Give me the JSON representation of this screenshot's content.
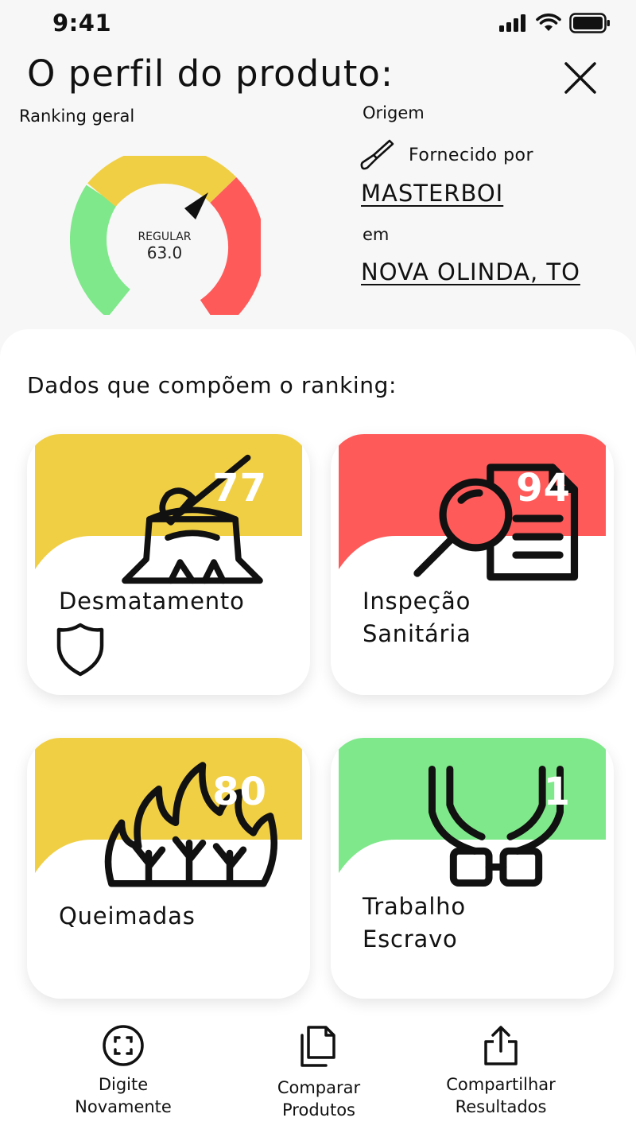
{
  "status_bar": {
    "time": "9:41"
  },
  "header": {
    "title": "O perfil do produto:",
    "close_icon": "close-icon"
  },
  "ranking": {
    "label": "Ranking geral",
    "status": "REGULAR",
    "score": "63.0",
    "score_value": 63.0,
    "colors": {
      "low": "#7ee88a",
      "mid": "#f0cf45",
      "high": "#ff5a5a"
    }
  },
  "origin": {
    "label": "Origem",
    "supplied_by_label": "Fornecido por",
    "supplier": "MASTERBOI",
    "em_label": "em",
    "location": "NOVA OLINDA, TO"
  },
  "panel": {
    "title": "Dados que compõem o ranking:"
  },
  "cards": [
    {
      "label": "Desmatamento",
      "score": "77",
      "color": "#f0cf45",
      "icon": "tree-stump-axe-icon"
    },
    {
      "label": "Inspeção\nSanitária",
      "score": "94",
      "color": "#ff5a5a",
      "icon": "magnifier-document-icon"
    },
    {
      "label": "Queimadas",
      "score": "80",
      "color": "#f0cf45",
      "icon": "fire-icon"
    },
    {
      "label": "Trabalho\nEscravo",
      "score": "1",
      "color": "#7ee88a",
      "icon": "chained-hands-icon"
    }
  ],
  "bottom_nav": [
    {
      "label": "Digite\nNovamente",
      "icon": "scan-icon"
    },
    {
      "label": "Comparar\nProdutos",
      "icon": "documents-icon"
    },
    {
      "label": "Compartilhar\nResultados",
      "icon": "share-icon"
    }
  ]
}
